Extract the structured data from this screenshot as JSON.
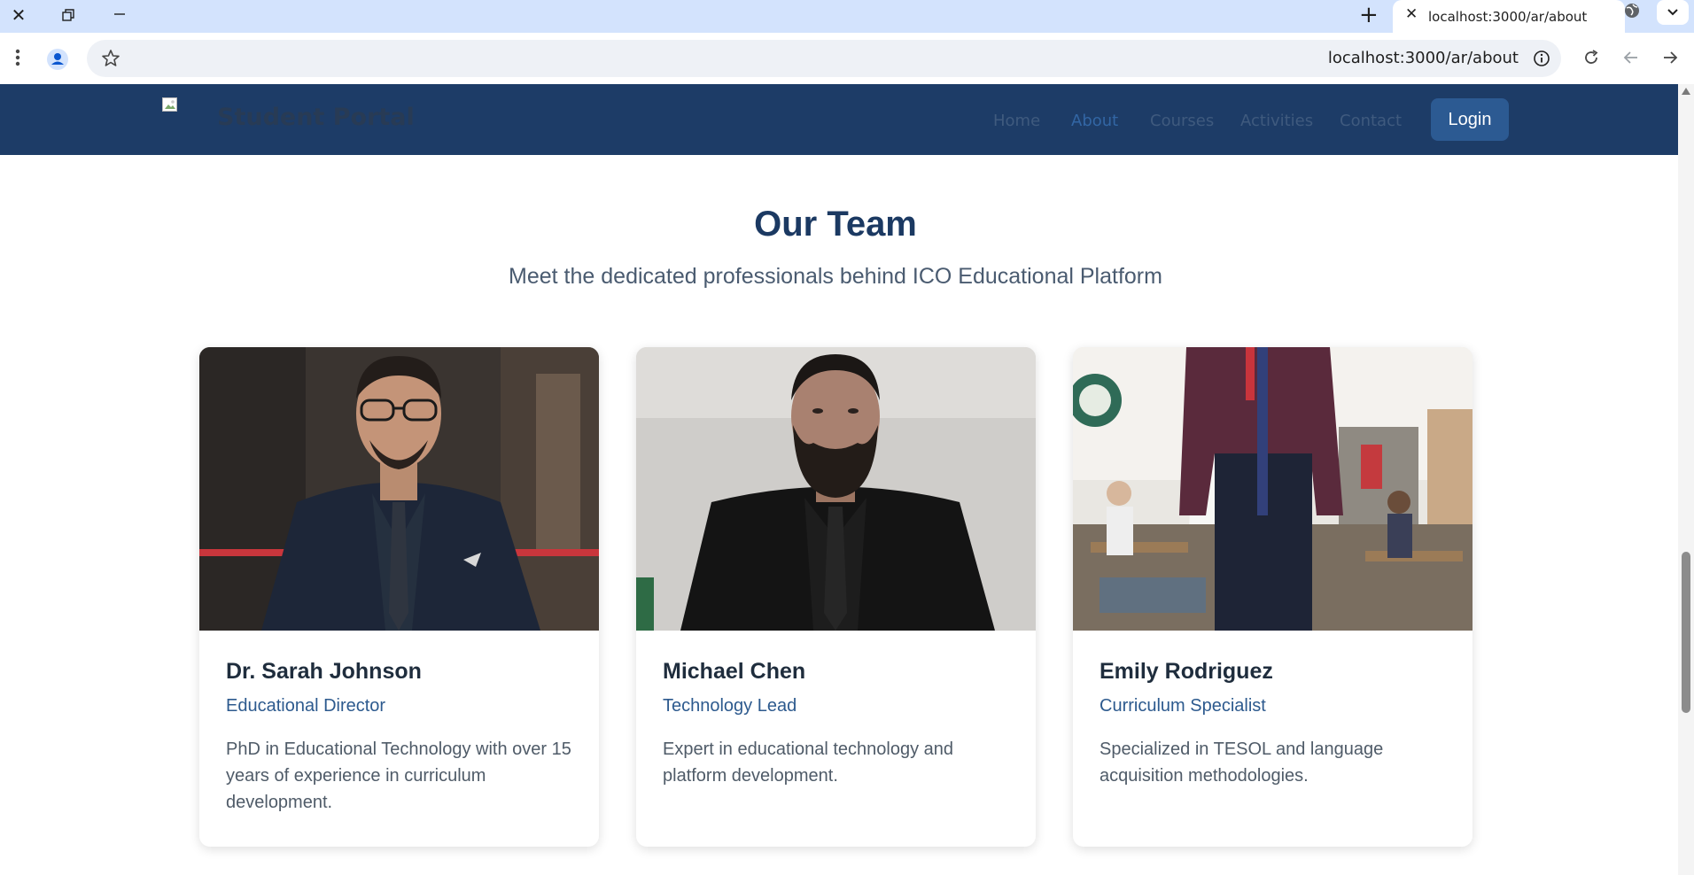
{
  "browser": {
    "tab_title": "localhost:3000/ar/about",
    "url": "localhost:3000/ar/about",
    "icons": [
      "close-icon",
      "restore-icon",
      "minimize-icon",
      "new-tab-icon",
      "globe-icon",
      "chevron-down-icon",
      "menu-dots-icon",
      "profile-icon",
      "star-icon",
      "info-icon",
      "reload-icon",
      "back-icon",
      "forward-icon"
    ]
  },
  "navbar": {
    "brand": "Student Portal",
    "links": [
      "Home",
      "About",
      "Courses",
      "Activities",
      "Contact"
    ],
    "active_link": "About",
    "login_label": "Login",
    "colors": {
      "background": "#1d3c67",
      "login_button": "#2c5a92"
    }
  },
  "team": {
    "title": "Our Team",
    "subtitle": "Meet the dedicated professionals behind ICO Educational Platform",
    "members": [
      {
        "name": "Dr. Sarah Johnson",
        "role": "Educational Director",
        "bio": "PhD in Educational Technology with over 15 years of experience in curriculum development."
      },
      {
        "name": "Michael Chen",
        "role": "Technology Lead",
        "bio": "Expert in educational technology and platform development."
      },
      {
        "name": "Emily Rodriguez",
        "role": "Curriculum Specialist",
        "bio": "Specialized in TESOL and language acquisition methodologies."
      }
    ]
  },
  "colors": {
    "heading": "#1b3962",
    "role_text": "#2d5a8e"
  }
}
